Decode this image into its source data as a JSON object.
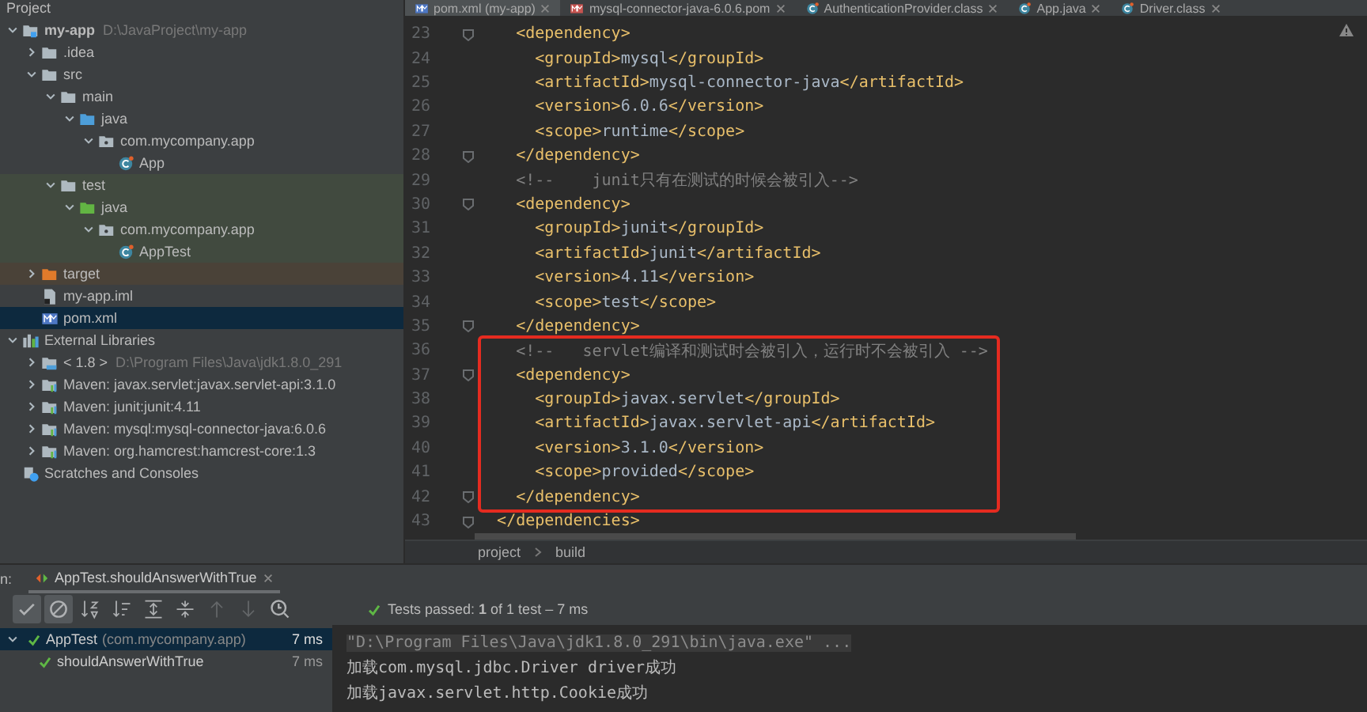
{
  "project_panel": {
    "title": "Project",
    "tree": [
      {
        "label": "my-app",
        "path": "D:\\JavaProject\\my-app",
        "kind": "module",
        "expanded": true,
        "selected": false,
        "children": [
          {
            "label": ".idea",
            "kind": "folder",
            "expanded": false,
            "selected": false
          },
          {
            "label": "src",
            "kind": "folder",
            "expanded": true,
            "selected": false,
            "children": [
              {
                "label": "main",
                "kind": "folder",
                "expanded": true,
                "selected": false,
                "children": [
                  {
                    "label": "java",
                    "kind": "source-root",
                    "expanded": true,
                    "selected": false,
                    "children": [
                      {
                        "label": "com.mycompany.app",
                        "kind": "package",
                        "expanded": true,
                        "selected": false,
                        "children": [
                          {
                            "label": "App",
                            "kind": "class",
                            "selected": false
                          }
                        ]
                      }
                    ]
                  }
                ]
              },
              {
                "label": "test",
                "kind": "folder",
                "expanded": true,
                "selected": false,
                "color": "#414a3f",
                "children": [
                  {
                    "label": "java",
                    "kind": "test-root",
                    "expanded": true,
                    "selected": false,
                    "color": "#414a3f",
                    "children": [
                      {
                        "label": "com.mycompany.app",
                        "kind": "package",
                        "expanded": true,
                        "selected": false,
                        "color": "#414a3f",
                        "children": [
                          {
                            "label": "AppTest",
                            "kind": "class",
                            "selected": false,
                            "color": "#414a3f"
                          }
                        ]
                      }
                    ]
                  }
                ]
              }
            ]
          },
          {
            "label": "target",
            "kind": "excluded-folder",
            "expanded": false,
            "selected": false,
            "color": "#4a4238"
          },
          {
            "label": "my-app.iml",
            "kind": "iml",
            "selected": false
          },
          {
            "label": "pom.xml",
            "kind": "maven",
            "selected": true
          }
        ]
      },
      {
        "label": "External Libraries",
        "kind": "libraries",
        "expanded": true,
        "selected": false,
        "children": [
          {
            "label": "< 1.8 >",
            "path": "D:\\Program Files\\Java\\jdk1.8.0_291",
            "kind": "jdk",
            "expanded": false,
            "selected": false
          },
          {
            "label": "Maven: javax.servlet:javax.servlet-api:3.1.0",
            "kind": "library",
            "expanded": false,
            "selected": false
          },
          {
            "label": "Maven: junit:junit:4.11",
            "kind": "library",
            "expanded": false,
            "selected": false
          },
          {
            "label": "Maven: mysql:mysql-connector-java:6.0.6",
            "kind": "library",
            "expanded": false,
            "selected": false
          },
          {
            "label": "Maven: org.hamcrest:hamcrest-core:1.3",
            "kind": "library",
            "expanded": false,
            "selected": false
          }
        ]
      },
      {
        "label": "Scratches and Consoles",
        "kind": "scratches",
        "selected": false
      }
    ]
  },
  "editor": {
    "tabs": [
      {
        "label": "pom.xml (my-app)",
        "kind": "maven",
        "selected": true
      },
      {
        "label": "mysql-connector-java-6.0.6.pom",
        "kind": "pom",
        "selected": false
      },
      {
        "label": "AuthenticationProvider.class",
        "kind": "class",
        "selected": false
      },
      {
        "label": "App.java",
        "kind": "class",
        "selected": false
      },
      {
        "label": "Driver.class",
        "kind": "class",
        "selected": false
      }
    ],
    "lines": [
      {
        "number": "23",
        "text": "    <dependency>",
        "kind": "xml",
        "fold": true,
        "boxed": false
      },
      {
        "number": "24",
        "text": "      <groupId>mysql</groupId>",
        "kind": "xml",
        "fold": false,
        "boxed": false
      },
      {
        "number": "25",
        "text": "      <artifactId>mysql-connector-java</artifactId>",
        "kind": "xml",
        "fold": false,
        "boxed": false
      },
      {
        "number": "26",
        "text": "      <version>6.0.6</version>",
        "kind": "xml",
        "fold": false,
        "boxed": false
      },
      {
        "number": "27",
        "text": "      <scope>runtime</scope>",
        "kind": "xml",
        "fold": false,
        "boxed": false
      },
      {
        "number": "28",
        "text": "    </dependency>",
        "kind": "xml",
        "fold": true,
        "boxed": false
      },
      {
        "number": "29",
        "text": "    <!--    junit只有在测试的时候会被引入-->",
        "kind": "comment",
        "fold": false,
        "boxed": false
      },
      {
        "number": "30",
        "text": "    <dependency>",
        "kind": "xml",
        "fold": true,
        "boxed": false
      },
      {
        "number": "31",
        "text": "      <groupId>junit</groupId>",
        "kind": "xml",
        "fold": false,
        "boxed": false
      },
      {
        "number": "32",
        "text": "      <artifactId>junit</artifactId>",
        "kind": "xml",
        "fold": false,
        "boxed": false
      },
      {
        "number": "33",
        "text": "      <version>4.11</version>",
        "kind": "xml",
        "fold": false,
        "boxed": false
      },
      {
        "number": "34",
        "text": "      <scope>test</scope>",
        "kind": "xml",
        "fold": false,
        "boxed": false
      },
      {
        "number": "35",
        "text": "    </dependency>",
        "kind": "xml",
        "fold": true,
        "boxed": false
      },
      {
        "number": "36",
        "text": "    <!--   servlet编译和测试时会被引入，运行时不会被引入 -->",
        "kind": "comment",
        "fold": false,
        "boxed": true
      },
      {
        "number": "37",
        "text": "    <dependency>",
        "kind": "xml",
        "fold": true,
        "boxed": true
      },
      {
        "number": "38",
        "text": "      <groupId>javax.servlet</groupId>",
        "kind": "xml",
        "fold": false,
        "boxed": true
      },
      {
        "number": "39",
        "text": "      <artifactId>javax.servlet-api</artifactId>",
        "kind": "xml",
        "fold": false,
        "boxed": true
      },
      {
        "number": "40",
        "text": "      <version>3.1.0</version>",
        "kind": "xml",
        "fold": false,
        "boxed": true
      },
      {
        "number": "41",
        "text": "      <scope>provided</scope>",
        "kind": "xml",
        "fold": false,
        "boxed": true
      },
      {
        "number": "42",
        "text": "    </dependency>",
        "kind": "xml",
        "fold": true,
        "boxed": true
      },
      {
        "number": "43",
        "text": "  </dependencies>",
        "kind": "xml",
        "fold": true,
        "boxed": false
      }
    ],
    "breadcrumbs": [
      "project",
      "build"
    ]
  },
  "run_panel": {
    "label": "n:",
    "tab": "AppTest.shouldAnswerWithTrue",
    "toolbar": [
      {
        "kind": "check",
        "on": true,
        "disabled": false
      },
      {
        "kind": "stop",
        "on": true,
        "disabled": false
      },
      {
        "kind": "sort-alpha",
        "on": false,
        "disabled": false
      },
      {
        "kind": "sort-time",
        "on": false,
        "disabled": false
      },
      {
        "kind": "expand",
        "on": false,
        "disabled": false
      },
      {
        "kind": "collapse",
        "on": false,
        "disabled": false
      },
      {
        "kind": "up",
        "on": false,
        "disabled": true
      },
      {
        "kind": "down",
        "on": false,
        "disabled": true
      },
      {
        "kind": "history",
        "on": false,
        "disabled": false
      }
    ],
    "status": "Tests passed: **1** of 1 test – 7 ms",
    "tests": [
      {
        "name": "AppTest",
        "package": "(com.mycompany.app)",
        "time": "7 ms",
        "expanded": true,
        "selected": true,
        "children": [
          {
            "name": "shouldAnswerWithTrue",
            "time": "7 ms",
            "selected": false
          }
        ]
      }
    ],
    "console": [
      {
        "text": "\"D:\\Program Files\\Java\\jdk1.8.0_291\\bin\\java.exe\" ...",
        "kind": "command"
      },
      {
        "text": "加载com.mysql.jdbc.Driver driver成功",
        "kind": "output"
      },
      {
        "text": "加载javax.servlet.http.Cookie成功",
        "kind": "output"
      }
    ]
  }
}
